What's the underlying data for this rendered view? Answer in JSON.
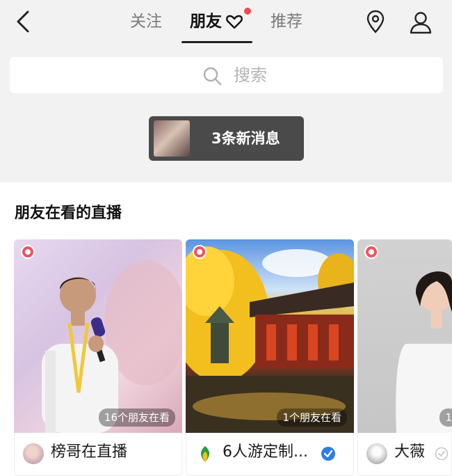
{
  "header": {
    "tabs": [
      {
        "label": "关注",
        "active": false
      },
      {
        "label": "朋友",
        "active": true,
        "badge": "red-dot"
      },
      {
        "label": "推荐",
        "active": false
      }
    ],
    "icons": [
      "back-icon",
      "heart-icon",
      "location-icon",
      "profile-icon"
    ]
  },
  "search": {
    "placeholder": "搜索"
  },
  "notice": {
    "text": "3条新消息"
  },
  "section": {
    "title": "朋友在看的直播"
  },
  "cards": [
    {
      "viewers": "16个朋友在看",
      "name": "榜哥在直播",
      "verified": false
    },
    {
      "viewers": "1个朋友在看",
      "name": "6人游定制...",
      "verified": true
    },
    {
      "viewers": "1",
      "name": "大薇",
      "verified": true
    }
  ],
  "colors": {
    "accent_red": "#f04a54",
    "verified_blue": "#2f7be8",
    "notice_bg": "#4a4a4a"
  }
}
